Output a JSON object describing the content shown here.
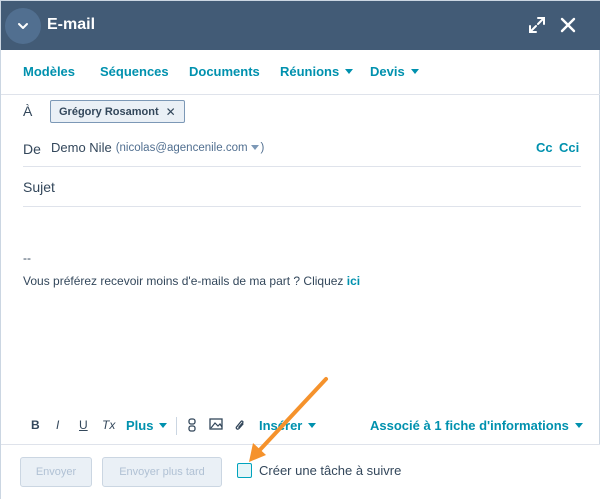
{
  "header": {
    "title": "E-mail"
  },
  "toolbar": {
    "items": [
      "Modèles",
      "Séquences",
      "Documents",
      "Réunions",
      "Devis"
    ]
  },
  "to": {
    "label": "À",
    "recipient": "Grégory Rosamont"
  },
  "from": {
    "label": "De",
    "name": "Demo Nile",
    "email": "(nicolas@agencenile.com"
  },
  "cc": {
    "cc_label": "Cc",
    "bcc_label": "Cci"
  },
  "subject": {
    "label": "Sujet"
  },
  "body": {
    "signature_sep": "--",
    "unsubscribe_text": "Vous préférez recevoir moins d'e-mails de ma part ? Cliquez ",
    "unsubscribe_link": "ici"
  },
  "editor_toolbar": {
    "bold": "B",
    "italic": "I",
    "underline": "U",
    "clear_format": "Tx",
    "more_label": "Plus",
    "insert_label": "Insérer",
    "associated_label": "Associé à 1 fiche d'informations"
  },
  "footer": {
    "send_label": "Envoyer",
    "send_later_label": "Envoyer plus tard",
    "task_label": "Créer une tâche à suivre"
  },
  "colors": {
    "header_bg": "#425b76",
    "accent": "#0091ae",
    "annotation_arrow": "#f5922c"
  }
}
